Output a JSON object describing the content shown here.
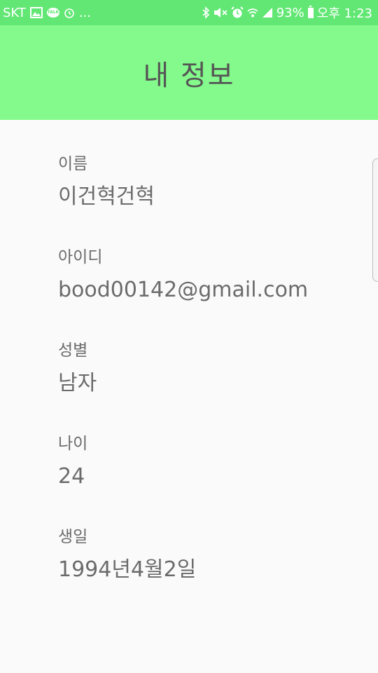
{
  "status_bar": {
    "carrier": "SKT",
    "more": "...",
    "battery": "93%",
    "time": "오후 1:23",
    "talk_label": "TALK"
  },
  "app_bar": {
    "title": "내 정보"
  },
  "profile": {
    "fields": [
      {
        "label": "이름",
        "value": "이건혁건혁"
      },
      {
        "label": "아이디",
        "value": "bood00142@gmail.com"
      },
      {
        "label": "성별",
        "value": "남자"
      },
      {
        "label": "나이",
        "value": "24"
      },
      {
        "label": "생일",
        "value": "1994년4월2일"
      }
    ]
  },
  "colors": {
    "status_bar": "#62e774",
    "app_bar": "#84fa8c",
    "text": "#6b6b6b",
    "background": "#fafafa"
  }
}
